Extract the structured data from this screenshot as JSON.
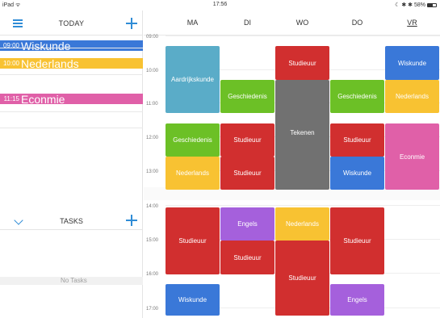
{
  "status_bar": {
    "device": "iPad ᯤ",
    "time": "17:56",
    "battery_icons": "☾ ✱ ✱ 58%"
  },
  "left": {
    "today_title": "TODAY",
    "today_items": [
      {
        "time": "09:00",
        "subject": "Wiskunde",
        "color": "#3a78d8"
      },
      {
        "time": "10:00",
        "subject": "Nederlands",
        "color": "#f8c232"
      },
      {
        "time": "11:15",
        "subject": "Econmie",
        "color": "#e060a8"
      }
    ],
    "tasks_title": "TASKS",
    "no_tasks": "No Tasks"
  },
  "timetable": {
    "days": [
      "MA",
      "DI",
      "WO",
      "DO",
      "VR"
    ],
    "active_day": "VR",
    "times": [
      "09:00",
      "10:00",
      "11:00",
      "12:00",
      "13:00",
      "14:00",
      "15:00",
      "16:00",
      "17:00"
    ],
    "lessons": [
      {
        "day": "MA",
        "subject": "Aardrijkskunde",
        "color": "#5aacc8"
      },
      {
        "day": "MA",
        "subject": "Geschiedenis",
        "color": "#6cc026"
      },
      {
        "day": "MA",
        "subject": "Nederlands",
        "color": "#f8c232"
      },
      {
        "day": "MA",
        "subject": "Studieuur",
        "color": "#d12f2f"
      },
      {
        "day": "MA",
        "subject": "Wiskunde",
        "color": "#3a78d8"
      },
      {
        "day": "DI",
        "subject": "Geschiedenis",
        "color": "#6cc026"
      },
      {
        "day": "DI",
        "subject": "Studieuur",
        "color": "#d12f2f"
      },
      {
        "day": "DI",
        "subject": "Studieuur",
        "color": "#d12f2f"
      },
      {
        "day": "DI",
        "subject": "Engels",
        "color": "#a560dc"
      },
      {
        "day": "DI",
        "subject": "Studieuur",
        "color": "#d12f2f"
      },
      {
        "day": "WO",
        "subject": "Studieuur",
        "color": "#d12f2f"
      },
      {
        "day": "WO",
        "subject": "Tekenen",
        "color": "#717171"
      },
      {
        "day": "WO",
        "subject": "Nederlands",
        "color": "#f8c232"
      },
      {
        "day": "WO",
        "subject": "Studieuur",
        "color": "#d12f2f"
      },
      {
        "day": "DO",
        "subject": "Geschiedenis",
        "color": "#6cc026"
      },
      {
        "day": "DO",
        "subject": "Studieuur",
        "color": "#d12f2f"
      },
      {
        "day": "DO",
        "subject": "Wiskunde",
        "color": "#3a78d8"
      },
      {
        "day": "DO",
        "subject": "Studieuur",
        "color": "#d12f2f"
      },
      {
        "day": "DO",
        "subject": "Engels",
        "color": "#a560dc"
      },
      {
        "day": "VR",
        "subject": "Wiskunde",
        "color": "#3a78d8"
      },
      {
        "day": "VR",
        "subject": "Nederlands",
        "color": "#f8c232"
      },
      {
        "day": "VR",
        "subject": "Econmie",
        "color": "#e060a8"
      }
    ]
  }
}
